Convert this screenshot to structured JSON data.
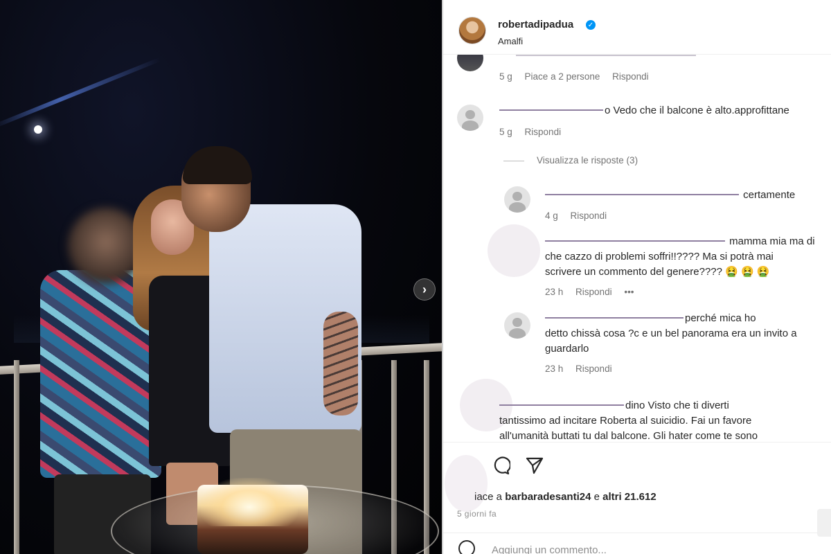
{
  "post": {
    "username": "robertadipadua",
    "location": "Amalfi",
    "verified_icon": "verified-badge-icon"
  },
  "comments": [
    {
      "id": "c0",
      "text": "",
      "meta": {
        "age": "5 g",
        "likes": "Piace a 2 persone",
        "reply": "Rispondi"
      }
    },
    {
      "id": "c1",
      "author_visible": "o",
      "text": "Vedo che il balcone è alto.approfittane",
      "meta": {
        "age": "5 g",
        "reply": "Rispondi"
      },
      "view_replies": "Visualizza le risposte (3)"
    },
    {
      "id": "r1",
      "mention": "",
      "text": "certamente",
      "meta": {
        "age": "4 g",
        "reply": "Rispondi"
      }
    },
    {
      "id": "r2",
      "text_line1": "mamma mia ma di",
      "text_line2": "che cazzo di problemi soffri!!???? Ma si potrà mai",
      "text_line3": "scrivere un commento del genere???? 🤮 🤮 🤮",
      "meta": {
        "age": "23 h",
        "reply": "Rispondi",
        "more": "•••"
      }
    },
    {
      "id": "r3",
      "mention": "",
      "text_line1": "perché mica ho",
      "text_line2": "detto chissà cosa ?c e un bel panorama era un invito a",
      "text_line3": "guardarlo",
      "meta": {
        "age": "23 h",
        "reply": "Rispondi"
      }
    },
    {
      "id": "c2",
      "text_line1": "dino Visto che ti diverti",
      "text_line2": "tantissimo ad incitare Roberta al suicidio. Fai un favore",
      "text_line3": "all'umanità buttati tu dal balcone. Gli hater come te sono"
    }
  ],
  "actions": {
    "comment_icon": "comment-icon",
    "share_icon": "share-icon",
    "likes_prefix": "iace a",
    "likes_user": "barbaradesanti24",
    "likes_joiner": "e",
    "likes_others": "altri 21.612",
    "date": "5 giorni fa",
    "add_comment_placeholder": "Aggiungi un commento..."
  }
}
